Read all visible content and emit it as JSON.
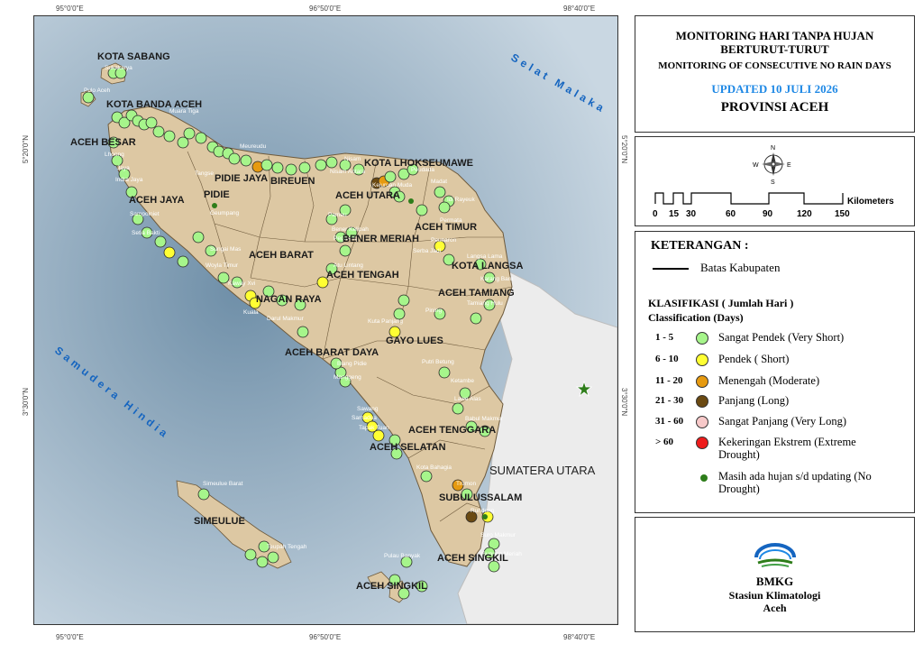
{
  "map": {
    "coords": {
      "top_left": "95°0'0\"E",
      "top_mid": "96°50'0\"E",
      "top_right": "98°40'0\"E",
      "bottom_left": "95°0'0\"E",
      "bottom_mid": "96°50'0\"E",
      "bottom_right": "98°40'0\"E",
      "left_top": "5°20'0\"N",
      "left_bottom": "3°30'0\"N",
      "right_top": "5°20'0\"N",
      "right_bottom": "3°30'0\"N"
    },
    "seas": {
      "north": "Selat Malaka",
      "south": "Samudera Hindia"
    },
    "neighbor": "SUMATERA UTARA",
    "regions": [
      "KOTA SABANG",
      "KOTA BANDA ACEH",
      "ACEH BESAR",
      "PIDIE JAYA",
      "BIREUEN",
      "KOTA LHOKSEUMAWE",
      "ACEH UTARA",
      "PIDIE",
      "ACEH JAYA",
      "ACEH TIMUR",
      "BENER MERIAH",
      "ACEH BARAT",
      "ACEH TENGAH",
      "KOTA LANGSA",
      "NAGAN RAYA",
      "ACEH TAMIANG",
      "ACEH BARAT DAYA",
      "GAYO LUES",
      "ACEH TENGGARA",
      "ACEH SELATAN",
      "SUBULUSSALAM",
      "SIMEULUE",
      "ACEH SINGKIL",
      "ACEH SINGKIL"
    ],
    "stations": [
      "Sukakarya",
      "Pulo Aceh",
      "Muara Tiga",
      "Lhoong",
      "Jaya",
      "Indra Jaya",
      "Meureudu",
      "Tangse",
      "Geumpang",
      "Sampoiniet",
      "Setia Bakti",
      "Sungai Mas",
      "Woyla Timur",
      "Kaway Xvi",
      "Kuala",
      "Darul Makmur",
      "Nisam Antara",
      "Nisam",
      "Peudada",
      "Pameu",
      "Bener Kelipah",
      "Atu Lintang",
      "Pegasing",
      "Permata",
      "Serba Jadi",
      "Peunaron",
      "Langsa Lama",
      "Karang Baru",
      "Tamiang Hulu",
      "Pining",
      "Kuta Panjang",
      "Putri Betung",
      "Blang Pidie",
      "Manggeng",
      "Ketambe",
      "Lawe Alas",
      "Babul Makmur",
      "Sawang",
      "Samadua",
      "Tapak Tuan",
      "Kota Bahagia",
      "Trumon",
      "Rundeng",
      "Suro Makmur",
      "Gunung Meriah",
      "Simeulue Barat",
      "Teupah Tengah",
      "Pulau Banyak",
      "Kejuruan Muda",
      "Madat",
      "Idi Rayeuk"
    ]
  },
  "title": {
    "line1": "MONITORING HARI TANPA HUJAN",
    "line2": "BERTURUT-TURUT",
    "line3": "MONITORING OF CONSECUTIVE NO RAIN DAYS",
    "updated": "UPDATED 10 JULI 2026",
    "province": "PROVINSI ACEH"
  },
  "scale": {
    "ticks": [
      "0",
      "15",
      "30",
      "60",
      "90",
      "120",
      "150"
    ],
    "unit": "Kilometers",
    "compass": {
      "n": "N",
      "s": "S",
      "e": "E",
      "w": "W"
    }
  },
  "legend": {
    "title": "KETERANGAN :",
    "boundary": "Batas Kabupaten",
    "class_title": "KLASIFIKASI ( Jumlah Hari )",
    "class_subtitle": "Classification (Days)",
    "items": [
      {
        "range": "1 - 5",
        "label": "Sangat Pendek (Very Short)",
        "color": "#a6f58b"
      },
      {
        "range": "6 - 10",
        "label": "Pendek ( Short)",
        "color": "#ffff33"
      },
      {
        "range": "11 - 20",
        "label": "Menengah (Moderate)",
        "color": "#e69a10"
      },
      {
        "range": "21 - 30",
        "label": "Panjang (Long)",
        "color": "#6b4a12"
      },
      {
        "range": "31 - 60",
        "label": "Sangat Panjang (Very Long)",
        "color": "#f7c9c9"
      },
      {
        "range": "> 60",
        "label": "Kekeringan Ekstrem (Extreme Drought)",
        "color": "#ee1c1c"
      },
      {
        "range": "",
        "label": "Masih ada hujan s/d updating (No Drought)",
        "color": "#2e7d1a"
      }
    ]
  },
  "logo": {
    "name": "BMKG",
    "sub1": "Stasiun Klimatologi",
    "sub2": "Aceh"
  }
}
